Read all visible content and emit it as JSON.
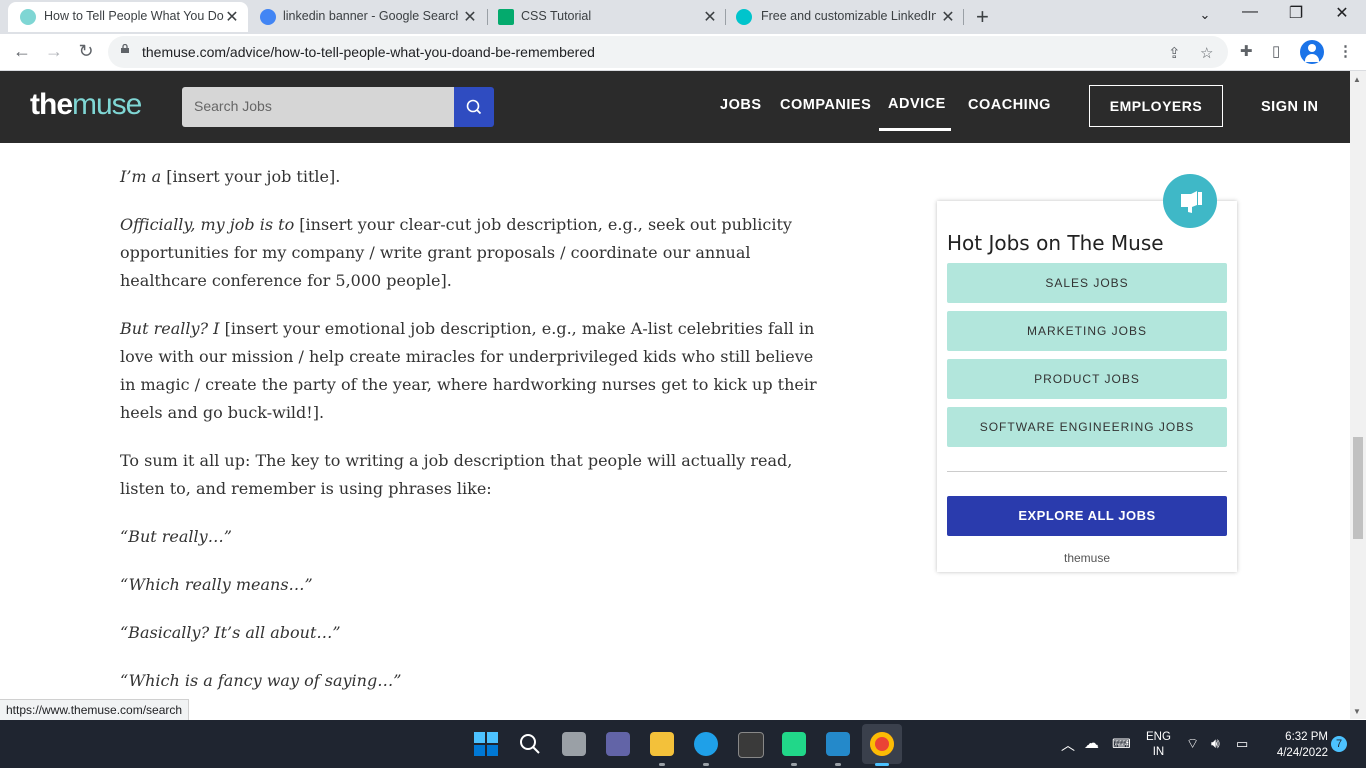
{
  "browser": {
    "tabs": [
      {
        "title": "How to Tell People What You Do",
        "favicon_color": "#7fd6d4",
        "active": true
      },
      {
        "title": "linkedin banner - Google Search",
        "favicon_color": "#4285f4",
        "active": false
      },
      {
        "title": "CSS Tutorial",
        "favicon_color": "#04aa6d",
        "active": false
      },
      {
        "title": "Free and customizable LinkedIn b",
        "favicon_color": "#00c4cc",
        "active": false
      }
    ],
    "url": "themuse.com/advice/how-to-tell-people-what-you-doand-be-remembered",
    "status_url": "https://www.themuse.com/search"
  },
  "site": {
    "logo_bold": "the",
    "logo_light": "muse",
    "search_placeholder": "Search Jobs",
    "nav": [
      "JOBS",
      "COMPANIES",
      "ADVICE",
      "COACHING"
    ],
    "active_nav": "ADVICE",
    "employers_label": "EMPLOYERS",
    "signin_label": "SIGN IN"
  },
  "article": {
    "p1_italic": "I’m a",
    "p1_rest": " [insert your job title].",
    "p2_italic": "Officially, my job is to",
    "p2_rest": " [insert your clear-cut job description, e.g., seek out publicity opportunities for my company / write grant proposals / coordinate our annual healthcare conference for 5,000 people].",
    "p3_italic": "But really? I",
    "p3_rest": " [insert your emotional job description, e.g., make A-list celebrities fall in love with our mission / help create miracles for underprivileged kids who still believe in magic / create the party of the year, where hardworking nurses get to kick up their heels and go buck-wild!].",
    "p4": "To sum it all up: The key to writing a job description that people will actually read, listen to, and remember is using phrases like:",
    "q1": "“But really…”",
    "q2": "“Which really means…”",
    "q3": "“Basically? It’s all about…”",
    "q4": "“Which is a fancy way of saying…”"
  },
  "widget": {
    "title": "Hot Jobs on The Muse",
    "jobs": [
      "SALES JOBS",
      "MARKETING JOBS",
      "PRODUCT JOBS",
      "SOFTWARE ENGINEERING JOBS"
    ],
    "explore_label": "EXPLORE ALL JOBS",
    "footer_logo": "themuse"
  },
  "taskbar": {
    "lang_top": "ENG",
    "lang_bottom": "IN",
    "time": "6:32 PM",
    "date": "4/24/2022",
    "notification_count": "7"
  }
}
